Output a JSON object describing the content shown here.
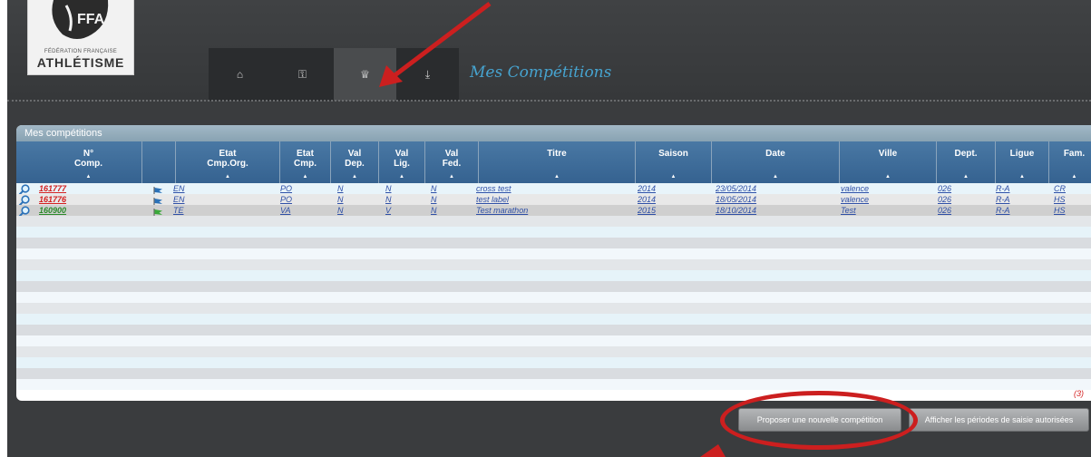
{
  "branding": {
    "federation_line": "FÉDÉRATION FRANÇAISE",
    "name": "ATHLÉTISME"
  },
  "nav": {
    "tabs": [
      {
        "icon": "home-icon",
        "glyph": "⌂",
        "active": false
      },
      {
        "icon": "key-icon",
        "glyph": "⚿",
        "active": false
      },
      {
        "icon": "trophy-icon",
        "glyph": "♕",
        "active": true
      },
      {
        "icon": "download-icon",
        "glyph": "⤓",
        "active": false
      }
    ]
  },
  "page": {
    "title": "Mes Compétitions"
  },
  "panel": {
    "title": "Mes compétitions"
  },
  "table": {
    "columns": [
      {
        "l1": "N°",
        "l2": "Comp.",
        "sort": true
      },
      {
        "l1": "",
        "l2": "",
        "sort": false
      },
      {
        "l1": "Etat",
        "l2": "Cmp.Org.",
        "sort": true
      },
      {
        "l1": "Etat",
        "l2": "Cmp.",
        "sort": true
      },
      {
        "l1": "Val",
        "l2": "Dep.",
        "sort": true
      },
      {
        "l1": "Val",
        "l2": "Lig.",
        "sort": true
      },
      {
        "l1": "Val",
        "l2": "Fed.",
        "sort": true
      },
      {
        "l1": "Titre",
        "l2": "",
        "sort": true
      },
      {
        "l1": "Saison",
        "l2": "",
        "sort": true
      },
      {
        "l1": "Date",
        "l2": "",
        "sort": true
      },
      {
        "l1": "Ville",
        "l2": "",
        "sort": true
      },
      {
        "l1": "Dept.",
        "l2": "",
        "sort": true
      },
      {
        "l1": "Ligue",
        "l2": "",
        "sort": true
      },
      {
        "l1": "Fam.",
        "l2": "",
        "sort": true
      }
    ],
    "sort_glyph": "▲",
    "rows": [
      {
        "num": "161777",
        "num_color": "red",
        "flag": "blue-flag-icon",
        "etat_org": "EN",
        "etat": "PO",
        "val_dep": "N",
        "val_lig": "N",
        "val_fed": "N",
        "titre": "cross test",
        "saison": "2014",
        "date": "23/05/2014",
        "ville": "valence",
        "dept": "026",
        "ligue": "R-A",
        "fam": "CR"
      },
      {
        "num": "161776",
        "num_color": "red",
        "flag": "blue-flag-icon",
        "etat_org": "EN",
        "etat": "PO",
        "val_dep": "N",
        "val_lig": "N",
        "val_fed": "N",
        "titre": "test label",
        "saison": "2014",
        "date": "18/05/2014",
        "ville": "valence",
        "dept": "026",
        "ligue": "R-A",
        "fam": "HS"
      },
      {
        "num": "160900",
        "num_color": "green",
        "flag": "green-flag-icon",
        "etat_org": "TE",
        "etat": "VA",
        "val_dep": "N",
        "val_lig": "V",
        "val_fed": "N",
        "titre": "Test marathon",
        "saison": "2015",
        "date": "18/10/2014",
        "ville": "Test",
        "dept": "026",
        "ligue": "R-A",
        "fam": "HS"
      }
    ],
    "record_count": "(3)"
  },
  "buttons": {
    "propose": "Proposer une nouvelle compétition",
    "periods": "Afficher les périodes de saisie autorisées"
  },
  "colors": {
    "accent_title": "#46a3cf",
    "header_bg": "#3a3c3e",
    "table_header": "#356290",
    "annotation_red": "#cc1f1f",
    "link": "#2e4fa6",
    "num_red": "#d42020",
    "num_green": "#2a8a2a"
  }
}
